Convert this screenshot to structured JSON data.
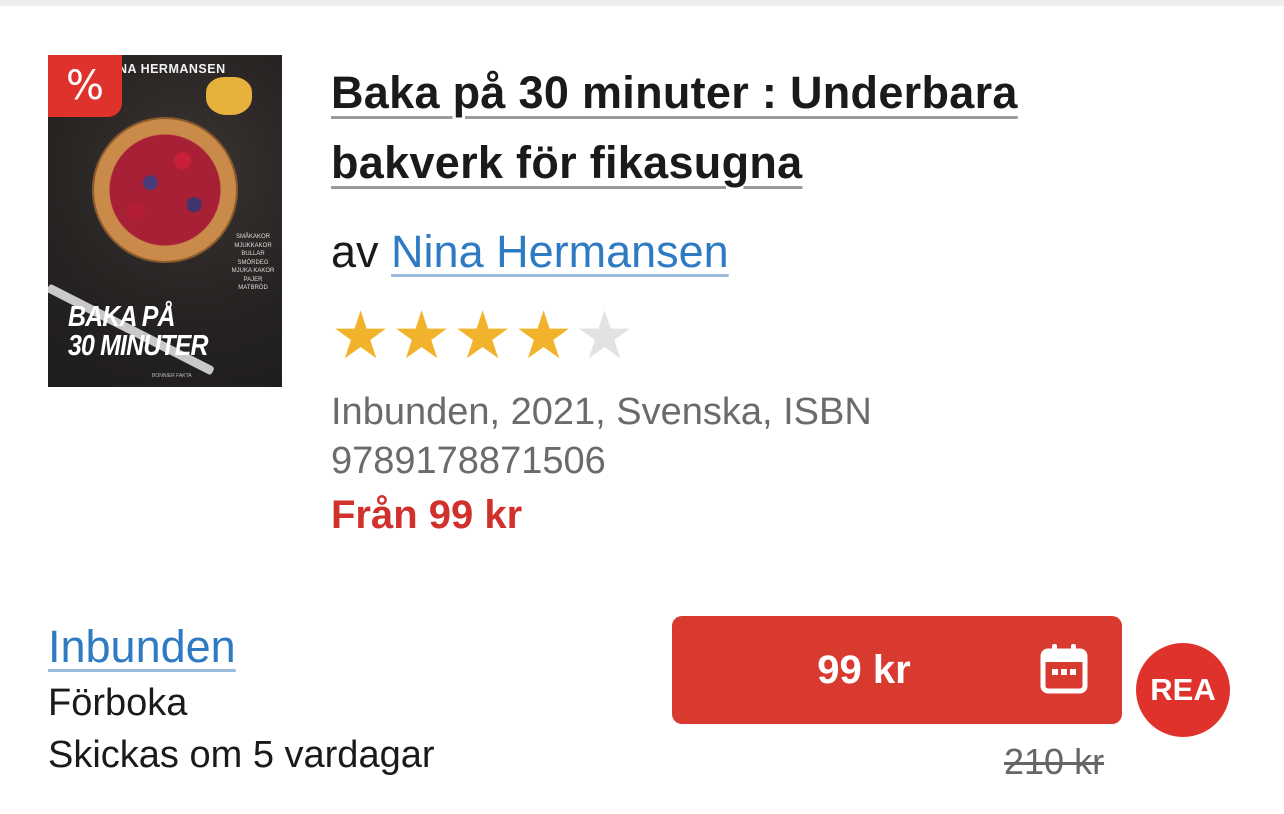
{
  "book": {
    "title": "Baka på 30 minuter : Underbara bakverk för fikasugna",
    "by_prefix": "av",
    "author": "Nina Hermansen",
    "rating": 4,
    "rating_max": 5,
    "format_info": "Inbunden, 2021, Svenska, ISBN 9789178871506",
    "from_price": "Från 99 kr",
    "cover": {
      "author_text": "NA HERMANSEN",
      "title_line1": "BAKA PÅ",
      "title_line2": "30 MINUTER",
      "topics": [
        "SMÅKAKOR",
        "MJUKKAKOR",
        "BULLAR",
        "SMÖRDEG",
        "MJUKA KAKOR",
        "PAJER",
        "MATBRÖD"
      ],
      "publisher": "BONNIER FAKTA"
    },
    "sale_tag": "%"
  },
  "offer": {
    "format": "Inbunden",
    "availability": "Förboka",
    "shipping": "Skickas om 5 vardagar",
    "price": "99 kr",
    "old_price": "210 kr",
    "badge": "REA"
  },
  "colors": {
    "accent_red": "#d93a30",
    "link_blue": "#2e7bc4",
    "star_yellow": "#f2b32c"
  }
}
